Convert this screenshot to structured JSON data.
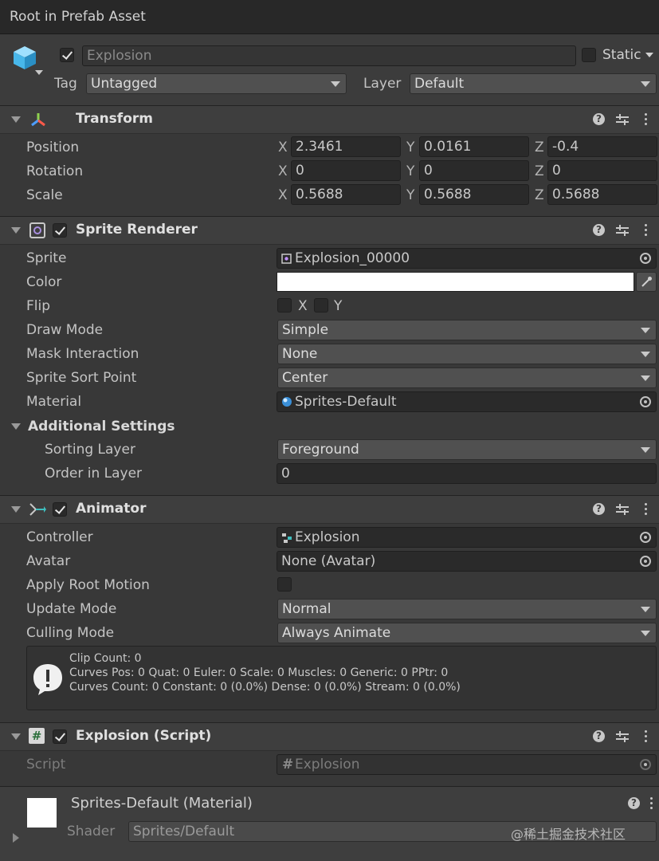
{
  "window_title": "Root in Prefab Asset",
  "header": {
    "name": "Explosion",
    "static_label": "Static",
    "tag_label": "Tag",
    "tag_value": "Untagged",
    "layer_label": "Layer",
    "layer_value": "Default",
    "active": true
  },
  "transform": {
    "title": "Transform",
    "position": {
      "label": "Position",
      "x": "2.3461",
      "y": "0.0161",
      "z": "-0.4"
    },
    "rotation": {
      "label": "Rotation",
      "x": "0",
      "y": "0",
      "z": "0"
    },
    "scale": {
      "label": "Scale",
      "x": "0.5688",
      "y": "0.5688",
      "z": "0.5688"
    },
    "axes": {
      "x": "X",
      "y": "Y",
      "z": "Z"
    }
  },
  "sprite_renderer": {
    "title": "Sprite Renderer",
    "sprite_label": "Sprite",
    "sprite_value": "Explosion_00000",
    "color_label": "Color",
    "color_value": "#ffffff",
    "flip_label": "Flip",
    "flip_x": "X",
    "flip_y": "Y",
    "draw_mode_label": "Draw Mode",
    "draw_mode_value": "Simple",
    "mask_label": "Mask Interaction",
    "mask_value": "None",
    "sort_point_label": "Sprite Sort Point",
    "sort_point_value": "Center",
    "material_label": "Material",
    "material_value": "Sprites-Default",
    "additional_label": "Additional Settings",
    "sorting_layer_label": "Sorting Layer",
    "sorting_layer_value": "Foreground",
    "order_label": "Order in Layer",
    "order_value": "0"
  },
  "animator": {
    "title": "Animator",
    "controller_label": "Controller",
    "controller_value": "Explosion",
    "avatar_label": "Avatar",
    "avatar_value": "None (Avatar)",
    "root_motion_label": "Apply Root Motion",
    "update_mode_label": "Update Mode",
    "update_mode_value": "Normal",
    "culling_label": "Culling Mode",
    "culling_value": "Always Animate",
    "info_line1": "Clip Count: 0",
    "info_line2": "Curves Pos: 0 Quat: 0 Euler: 0 Scale: 0 Muscles: 0 Generic: 0 PPtr: 0",
    "info_line3": "Curves Count: 0 Constant: 0 (0.0%) Dense: 0 (0.0%) Stream: 0 (0.0%)"
  },
  "script_component": {
    "title": "Explosion (Script)",
    "script_label": "Script",
    "script_value": "Explosion"
  },
  "material": {
    "title": "Sprites-Default (Material)",
    "shader_label": "Shader",
    "shader_value": "Sprites/Default",
    "watermark": "@稀土掘金技术社区"
  },
  "icons": [
    "cube-icon",
    "transform-icon",
    "sprite-renderer-icon",
    "animator-icon",
    "script-hash-icon",
    "help-icon",
    "presets-icon",
    "more-icon",
    "object-picker-icon",
    "eyedropper-icon",
    "info-icon"
  ]
}
